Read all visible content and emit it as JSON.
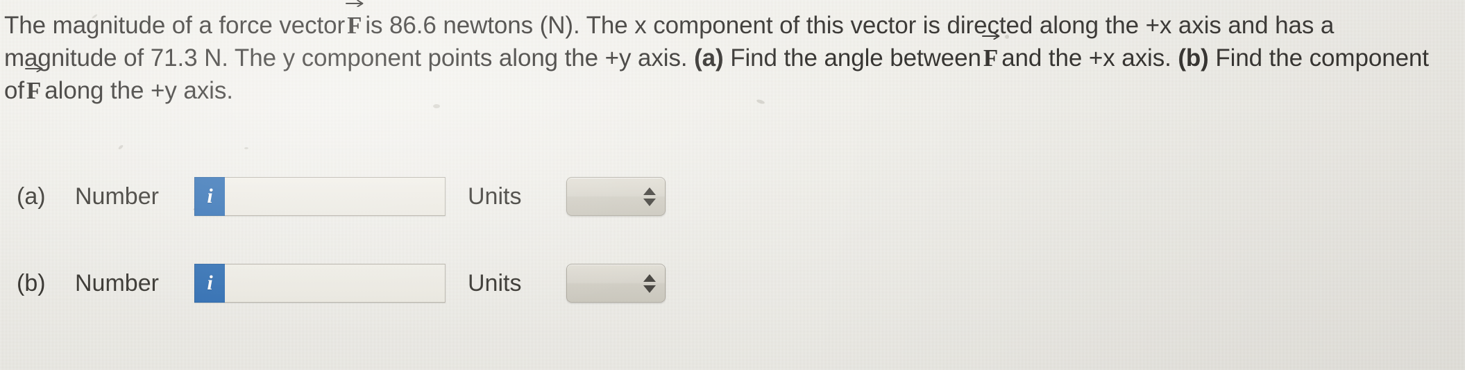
{
  "problem": {
    "vector_symbol": "F",
    "line1_part1": "The magnitude of a force vector",
    "line1_part2": "is 86.6 newtons (N). The",
    "line1_part3": "x",
    "line1_part4": "component of this vector is directed along the +x axis and has a",
    "line2_part1": "magnitude of 71.3 N. The",
    "line2_part2": "y",
    "line2_part3": "component points along the +y axis.",
    "line2_bold_a": "(a)",
    "line2_part4": "Find the angle between",
    "line2_part5": "and the +x axis.",
    "line2_bold_b": "(b)",
    "line2_part6": "Find the component",
    "line3_part1": "of",
    "line3_part2": "along the +y axis."
  },
  "answers": [
    {
      "part": "(a)",
      "number_label": "Number",
      "info_glyph": "i",
      "number_value": "",
      "number_placeholder": "",
      "units_label": "Units",
      "units_value": "",
      "units_options": [
        ""
      ]
    },
    {
      "part": "(b)",
      "number_label": "Number",
      "info_glyph": "i",
      "number_value": "",
      "number_placeholder": "",
      "units_label": "Units",
      "units_value": "",
      "units_options": [
        ""
      ]
    }
  ],
  "colors": {
    "info_tag_blue": "#3573b7",
    "paper": "#eeebe2",
    "text": "#33312e"
  }
}
